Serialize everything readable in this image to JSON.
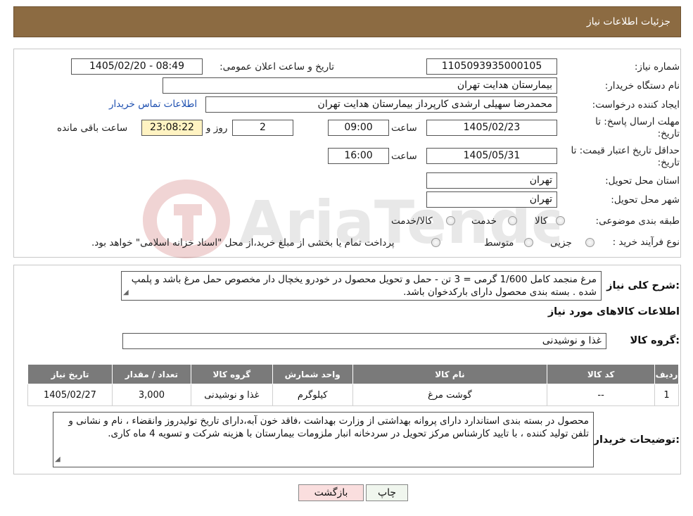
{
  "header": {
    "title": "جزئیات اطلاعات نیاز"
  },
  "info": {
    "need_number_label": "شماره نیاز:",
    "need_number": "1105093935000105",
    "announce_label": "تاریخ و ساعت اعلان عمومی:",
    "announce_value": "1405/02/20 - 08:49",
    "buyer_org_label": "نام دستگاه خریدار:",
    "buyer_org": "بیمارستان هدایت تهران",
    "creator_label": "ایجاد کننده درخواست:",
    "creator": "محمدرضا سهیلی ارشدی کارپرداز بیمارستان هدایت تهران",
    "contact_link": "اطلاعات تماس خریدار",
    "deadline_label_1": "مهلت ارسال پاسخ: تا",
    "deadline_label_2": "تاریخ:",
    "deadline_date": "1405/02/23",
    "time_label": "ساعت",
    "deadline_time": "09:00",
    "days_value": "2",
    "days_label": "روز و",
    "remaining_time": "23:08:22",
    "remaining_label": "ساعت باقی مانده",
    "validity_label_1": "حداقل تاریخ اعتبار قیمت: تا",
    "validity_label_2": "تاریخ:",
    "validity_date": "1405/05/31",
    "validity_time": "16:00",
    "province_label": "استان محل تحویل:",
    "province": "تهران",
    "city_label": "شهر محل تحویل:",
    "city": "تهران",
    "category_label": "طبقه بندی موضوعی:",
    "category_options": [
      "کالا",
      "خدمت",
      "کالا/خدمت"
    ],
    "process_label": "نوع فرآیند خرید :",
    "process_options": [
      "جزیی",
      "متوسط"
    ],
    "process_note": "پرداخت تمام یا بخشی از مبلغ خرید،از محل \"اسناد خزانه اسلامی\" خواهد بود."
  },
  "watermark": {
    "text": "AriaTender.neT"
  },
  "details": {
    "summary_label": "شرح کلی نیاز:",
    "summary_text": "مرغ منجمد کامل 1/600 گرمی = 3 تن - حمل و تحویل محصول در خودرو یخچال دار مخصوص حمل مرغ باشد و پلمپ شده . بسته بندی  محصول دارای بارکدخوان باشد.",
    "goods_info_title": "اطلاعات کالاهای مورد نیاز",
    "goods_group_label": "گروه کالا:",
    "goods_group": "غذا و نوشیدنی",
    "table": {
      "headers": [
        "ردیف",
        "کد کالا",
        "نام کالا",
        "واحد شمارش",
        "گروه کالا",
        "تعداد / مقدار",
        "تاریخ نیاز"
      ],
      "rows": [
        [
          "1",
          "--",
          "گوشت مرغ",
          "کیلوگرم",
          "غذا و نوشیدنی",
          "3,000",
          "1405/02/27"
        ]
      ]
    },
    "buyer_notes_label": "توضیحات خریدار:",
    "buyer_notes": "محصول در بسته بندی استاندارد دارای پروانه بهداشتی از وزارت بهداشت ،فاقد خون آبه،دارای تاریخ تولیدروز وانقضاء ، نام و نشانی و تلفن تولید کننده ، با تایید کارشناس مرکز تحویل در سردخانه انبار ملزومات بیمارستان با هزینه شرکت و تسویه 4 ماه کاری."
  },
  "buttons": {
    "back": "بازگشت",
    "print": "چاپ"
  }
}
